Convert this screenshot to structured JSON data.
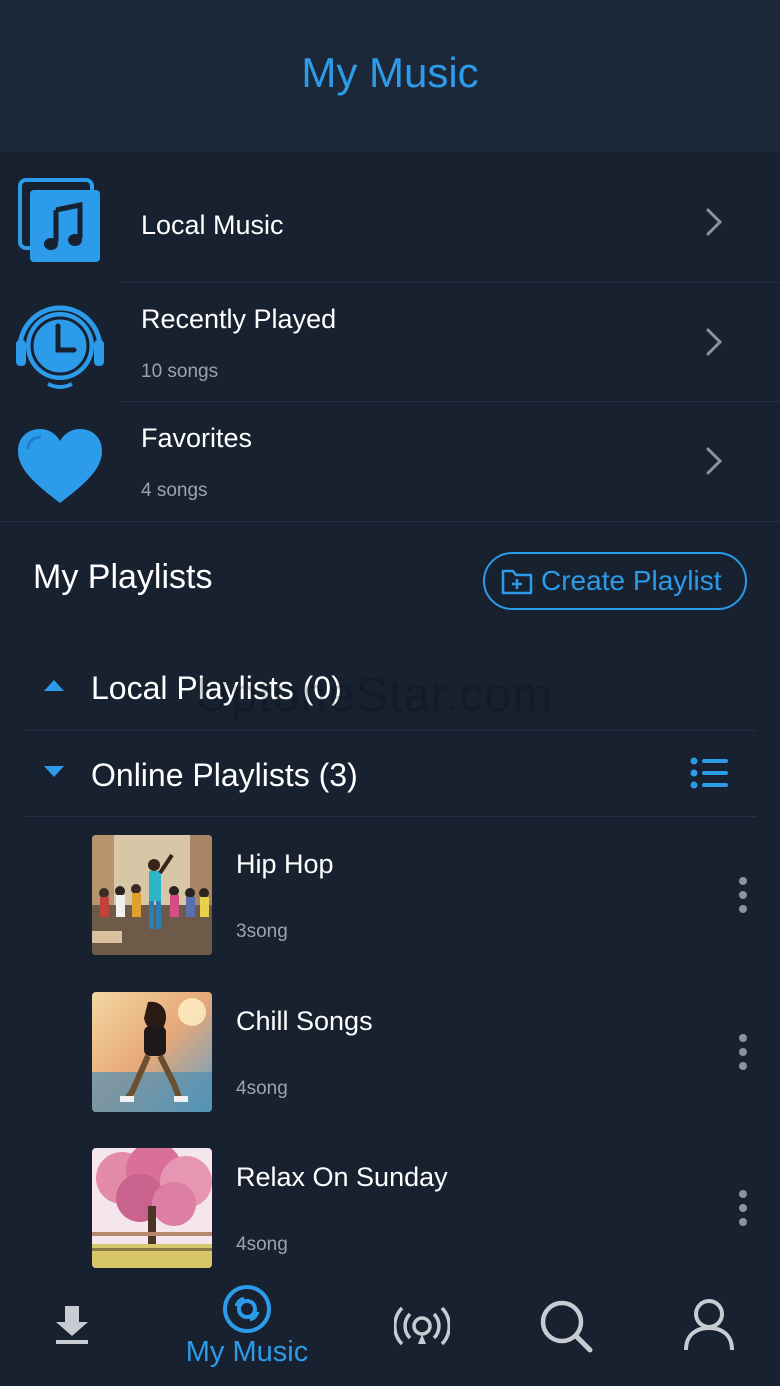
{
  "header": {
    "title": "My Music"
  },
  "library": [
    {
      "label": "Local Music",
      "sub": ""
    },
    {
      "label": "Recently Played",
      "sub": "10 songs"
    },
    {
      "label": "Favorites",
      "sub": "4 songs"
    }
  ],
  "playlists_section": {
    "title": "My Playlists",
    "create_label": "Create Playlist"
  },
  "groups": {
    "local": "Local Playlists (0)",
    "online": "Online Playlists (3)"
  },
  "playlists": [
    {
      "name": "Hip Hop",
      "count": "3song"
    },
    {
      "name": "Chill Songs",
      "count": "4song"
    },
    {
      "name": "Relax On Sunday",
      "count": "4song"
    }
  ],
  "watermark": "UptoneStar.com",
  "nav": {
    "active_label": "My Music",
    "items": [
      "download-icon",
      "my-music-disc-icon",
      "radio-broadcast-icon",
      "search-icon",
      "profile-icon"
    ]
  },
  "colors": {
    "accent": "#2b9bea",
    "background": "#172130",
    "header": "#1c2838",
    "muted": "#9aa3ae"
  }
}
